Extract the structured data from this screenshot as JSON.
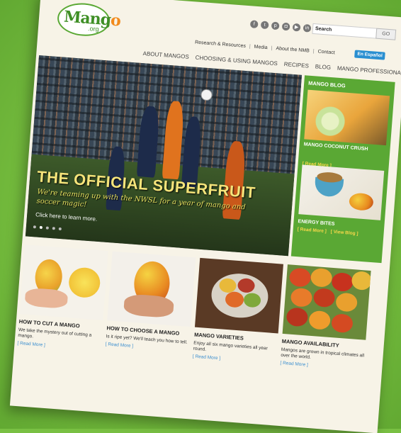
{
  "header": {
    "logo_text": "Mang",
    "logo_o": "o",
    "logo_org": ".org",
    "search_placeholder": "Search",
    "go_label": "GO",
    "espanol_label": "En Español",
    "social_icons": [
      "facebook-icon",
      "twitter-icon",
      "pinterest-icon",
      "instagram-icon",
      "youtube-icon",
      "linkedin-icon"
    ]
  },
  "utility_links": [
    "Research & Resources",
    "Media",
    "About the NMB",
    "Contact"
  ],
  "nav": [
    "ABOUT MANGOS",
    "CHOOSING & USING MANGOS",
    "RECIPES",
    "BLOG",
    "MANGO PROFESSIONALS"
  ],
  "hero": {
    "title": "THE OFFICIAL SUPERFRUIT",
    "subtitle": "We're teaming up with the NWSL for a year of mango and soccer magic!",
    "cta": "Click here to learn more."
  },
  "blog": {
    "heading": "MANGO BLOG",
    "post1_title": "MANGO COCONUT CRUSH",
    "post1_read": "[ Read More ]",
    "post2_title": "ENERGY BITES",
    "post2_read": "[ Read More ]",
    "view_blog": "[ View Blog ]"
  },
  "cards": [
    {
      "title": "HOW TO CUT A MANGO",
      "desc": "We take the mystery out of cutting a mango.",
      "read": "[ Read More ]"
    },
    {
      "title": "HOW TO CHOOSE A MANGO",
      "desc": "Is it ripe yet? We'll teach you how to tell.",
      "read": "[ Read More ]"
    },
    {
      "title": "MANGO VARIETIES",
      "desc": "Enjoy all six mango varieties all year round.",
      "read": "[ Read More ]"
    },
    {
      "title": "MANGO AVAILABILITY",
      "desc": "Mangos are grown in tropical climates all over the world.",
      "read": "[ Read More ]"
    }
  ],
  "colors": {
    "brand_green": "#5aa834",
    "accent_orange": "#f28a1c",
    "background_green": "#79c043"
  }
}
